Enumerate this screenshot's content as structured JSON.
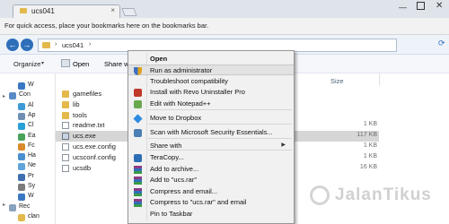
{
  "browser": {
    "tab_title": "ucs041",
    "tab_close": "×",
    "bookmarks_text": "For quick access, place your bookmarks here on the bookmarks bar.",
    "min_glyph": "—",
    "close_glyph": "✕"
  },
  "address": {
    "back": "←",
    "forward": "→",
    "sep": "›",
    "path": "ucs041",
    "refresh": "⟳"
  },
  "toolbar": {
    "organize": "Organize",
    "organize_arrow": "▾",
    "open": "Open",
    "share_with": "Share with"
  },
  "navpane": {
    "arrow": "▸",
    "items": [
      {
        "label": "W",
        "color": "#3b78c4"
      },
      {
        "label": "Con",
        "color": "#5a8ac6"
      },
      {
        "label": "Al",
        "color": "#3d9ad6"
      },
      {
        "label": "Ap",
        "color": "#6e8fb3"
      },
      {
        "label": "Cl",
        "color": "#2aa0d8"
      },
      {
        "label": "Ea",
        "color": "#49a35a"
      },
      {
        "label": "Fc",
        "color": "#d98b2b"
      },
      {
        "label": "Ha",
        "color": "#4a8fd0"
      },
      {
        "label": "Ne",
        "color": "#5fa3d9"
      },
      {
        "label": "Pr",
        "color": "#3f6fb0"
      },
      {
        "label": "Sy",
        "color": "#7b7b7b"
      },
      {
        "label": "W",
        "color": "#3b78c4"
      },
      {
        "label": "Rec",
        "color": "#8aa3bd"
      },
      {
        "label": "clan",
        "color": "#e3b94c"
      },
      {
        "label": "ca",
        "color": "#e3b94c"
      }
    ]
  },
  "filelist": {
    "size_header": "Size",
    "files": [
      {
        "name": "gamefiles",
        "type": "folder",
        "size": ""
      },
      {
        "name": "lib",
        "type": "folder",
        "size": ""
      },
      {
        "name": "tools",
        "type": "folder",
        "size": ""
      },
      {
        "name": "readme.txt",
        "type": "doc",
        "size": "1 KB"
      },
      {
        "name": "ucs.exe",
        "type": "exe",
        "size": "117 KB"
      },
      {
        "name": "ucs.exe.config",
        "type": "doc",
        "size": "1 KB"
      },
      {
        "name": "ucsconf.config",
        "type": "doc",
        "size": "1 KB"
      },
      {
        "name": "ucsdb",
        "type": "doc",
        "size": "16 KB"
      }
    ]
  },
  "context_menu": {
    "submenu_arrow": "▶",
    "items": [
      {
        "label": "Open",
        "bold": true,
        "icon": "none-icon",
        "color": ""
      },
      {
        "label": "Run as administrator",
        "icon": "shield-icon",
        "color": "#e0a21c"
      },
      {
        "label": "Troubleshoot compatibility",
        "icon": "none-icon",
        "color": ""
      },
      {
        "label": "Install with Revo Uninstaller Pro",
        "icon": "revo-icon",
        "color": "#c0392b"
      },
      {
        "label": "Edit with Notepad++",
        "icon": "notepad-icon",
        "color": "#6aa84f"
      },
      {
        "label": "Move to Dropbox",
        "icon": "dropbox-icon",
        "color": "#2d8be0"
      },
      {
        "label": "Scan with Microsoft Security Essentials...",
        "icon": "mse-icon",
        "color": "#4a7fb5"
      },
      {
        "label": "Share with",
        "icon": "none-icon",
        "color": ""
      },
      {
        "label": "TeraCopy...",
        "icon": "teracopy-icon",
        "color": "#2c6db5"
      },
      {
        "label": "Add to archive...",
        "icon": "winrar-icon",
        "color": "#8e3b86"
      },
      {
        "label": "Add to \"ucs.rar\"",
        "icon": "winrar-icon",
        "color": "#8e3b86"
      },
      {
        "label": "Compress and email...",
        "icon": "winrar-icon",
        "color": "#8e3b86"
      },
      {
        "label": "Compress to \"ucs.rar\" and email",
        "icon": "winrar-icon",
        "color": "#8e3b86"
      },
      {
        "label": "Pin to Taskbar",
        "icon": "none-icon",
        "color": ""
      }
    ]
  },
  "watermark": {
    "text": "JalanTikus"
  }
}
